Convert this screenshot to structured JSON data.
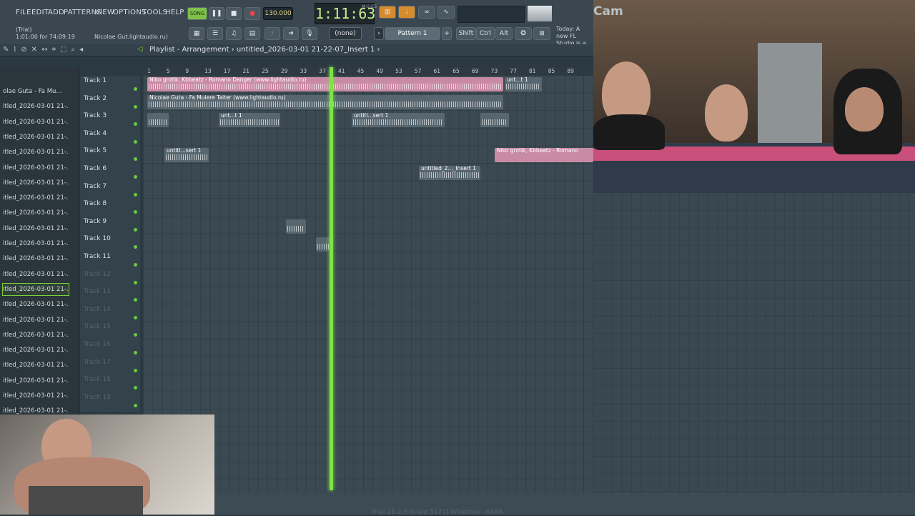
{
  "menu": [
    "FILE",
    "EDIT",
    "ADD",
    "PATTERNS",
    "VIEW",
    "OPTIONS",
    "TOOLS",
    "HELP"
  ],
  "hint": {
    "trial": "(Trial)",
    "time_info": "1:01:00 for 74:09:19",
    "project": "Nicolae Gut.lightaudio.ru)"
  },
  "transport": {
    "song_label": "SONG",
    "tempo": "130.000",
    "time": "1:11:63",
    "time_unit": "M:S:CS"
  },
  "pattern": {
    "name": "Pattern 1",
    "none": "(none)"
  },
  "keys": {
    "shift": "Shift",
    "ctrl": "Ctrl",
    "alt": "Alt"
  },
  "news": "Today: A new FL Studio is a",
  "playlist": {
    "title": "Playlist - Arrangement",
    "breadcrumb": "untitled_2026-03-01 21-22-07_Insert 1"
  },
  "browser": {
    "items": [
      "olae Guta - Fa Mu...",
      "itled_2026-03-01 21-...",
      "itled_2026-03-01 21-...",
      "itled_2026-03-01 21-...",
      "itled_2026-03-01 21-...",
      "itled_2026-03-01 21-...",
      "itled_2026-03-01 21-...",
      "itled_2026-03-01 21-...",
      "itled_2026-03-01 21-...",
      "itled_2026-03-01 21-...",
      "itled_2026-03-01 21-...",
      "itled_2026-03-01 21-...",
      "itled_2026-03-01 21-...",
      "itled_2026-03-01 21-...",
      "itled_2026-03-01 21-...",
      "itled_2026-03-01 21-...",
      "itled_2026-03-01 21-...",
      "itled_2026-03-01 21-...",
      "itled_2026-03-01 21-...",
      "itled_2026-03-01 21-...",
      "itled_2026-03-01 21-...",
      "itled_2026-03-01 21-..."
    ],
    "selected_index": 13
  },
  "ruler": [
    "1",
    "5",
    "9",
    "13",
    "17",
    "21",
    "25",
    "29",
    "33",
    "37",
    "41",
    "45",
    "49",
    "53",
    "57",
    "61",
    "65",
    "69",
    "73",
    "77",
    "81",
    "85",
    "89"
  ],
  "tracks": [
    "Track 1",
    "Track 2",
    "Track 3",
    "Track 4",
    "Track 5",
    "Track 6",
    "Track 7",
    "Track 8",
    "Track 9",
    "Track 10",
    "Track 11",
    "Track 12",
    "Track 13",
    "Track 14",
    "Track 15",
    "Track 16",
    "Track 17",
    "Track 18",
    "Track 19"
  ],
  "clips": {
    "c1": "Niko grotik, Kbbeatz - Romano Danger (www.lightaudio.ru)",
    "c2": "Nicolae Guta - Fa Muiere Taiter (www.lightaudio.ru)",
    "c3": "untitl...sert 1",
    "c4": "untitl...sert 1",
    "c5": "unt...t 1",
    "c6": "untitl...sert 1",
    "c7": "Niko grotik, Kbbeatz - Romano",
    "c8": "untitled_2..._Insert 1",
    "c9": "unt...t 1"
  },
  "webcam": {
    "label": "Cam"
  },
  "status": "Trial  25.2.3 (build 5171)  Windows - 64Bit"
}
